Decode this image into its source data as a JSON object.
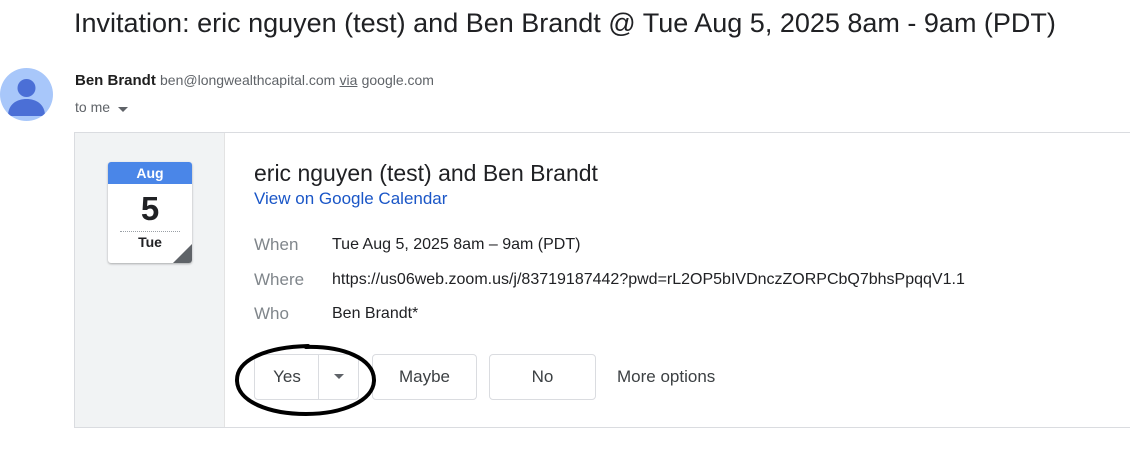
{
  "email": {
    "subject": "Invitation: eric nguyen (test) and Ben Brandt @ Tue Aug 5, 2025 8am - 9am (PDT)",
    "sender_name": "Ben Brandt",
    "sender_email": "ben@longwealthcapital.com",
    "via_label": "via",
    "via_domain": "google.com",
    "recipient_label": "to me",
    "avatar_icon": "person-icon"
  },
  "calendar_icon": {
    "month": "Aug",
    "day": "5",
    "weekday": "Tue",
    "accent_color": "#4a86e8"
  },
  "event": {
    "title": "eric nguyen (test) and Ben Brandt",
    "view_link": "View on Google Calendar",
    "details": [
      {
        "label": "When",
        "value": "Tue Aug 5, 2025 8am – 9am (PDT)"
      },
      {
        "label": "Where",
        "value": "https://us06web.zoom.us/j/83719187442?pwd=rL2OP5bIVDnczZORPCbQ7bhsPpqqV1.1"
      },
      {
        "label": "Who",
        "value": "Ben Brandt*"
      }
    ]
  },
  "rsvp": {
    "yes": "Yes",
    "maybe": "Maybe",
    "no": "No",
    "more_options": "More options"
  }
}
